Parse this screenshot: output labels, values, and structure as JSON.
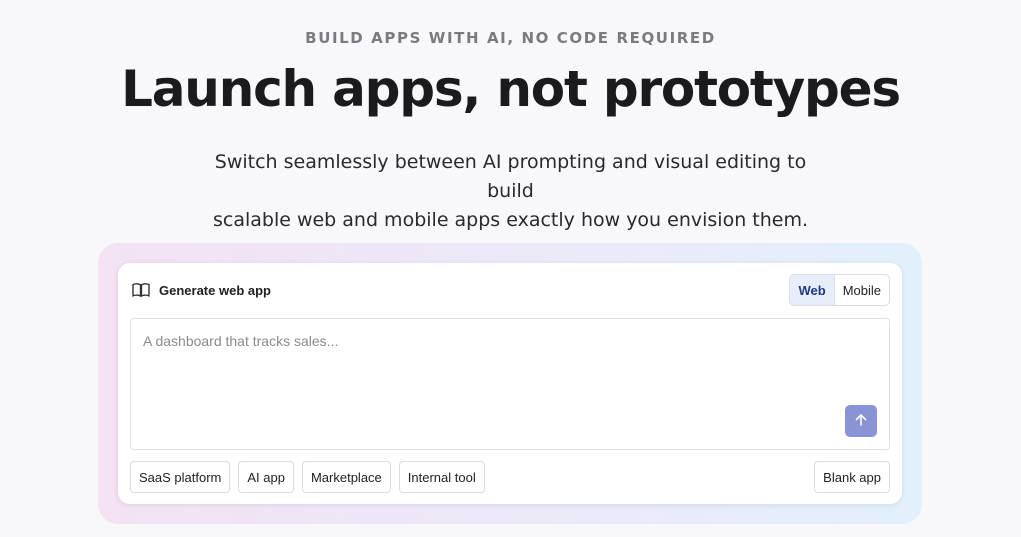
{
  "hero": {
    "eyebrow": "BUILD APPS WITH AI, NO CODE REQUIRED",
    "headline": "Launch apps, not prototypes",
    "subtitle_line1": "Switch seamlessly between AI prompting and visual editing to build",
    "subtitle_line2": "scalable web and mobile apps exactly how you envision them."
  },
  "builder": {
    "generate_label": "Generate web app",
    "generate_icon": "book-open-icon",
    "toggle": {
      "options": [
        "Web",
        "Mobile"
      ],
      "selected": "Web"
    },
    "prompt": {
      "placeholder": "A dashboard that tracks sales...",
      "value": ""
    },
    "send_icon": "arrow-up-icon",
    "colors": {
      "send_button": "#8a93d6",
      "toggle_active_bg": "#e7edf9",
      "toggle_active_text": "#1f3b82"
    },
    "templates": [
      "SaaS platform",
      "AI app",
      "Marketplace",
      "Internal tool"
    ],
    "blank_label": "Blank app"
  }
}
